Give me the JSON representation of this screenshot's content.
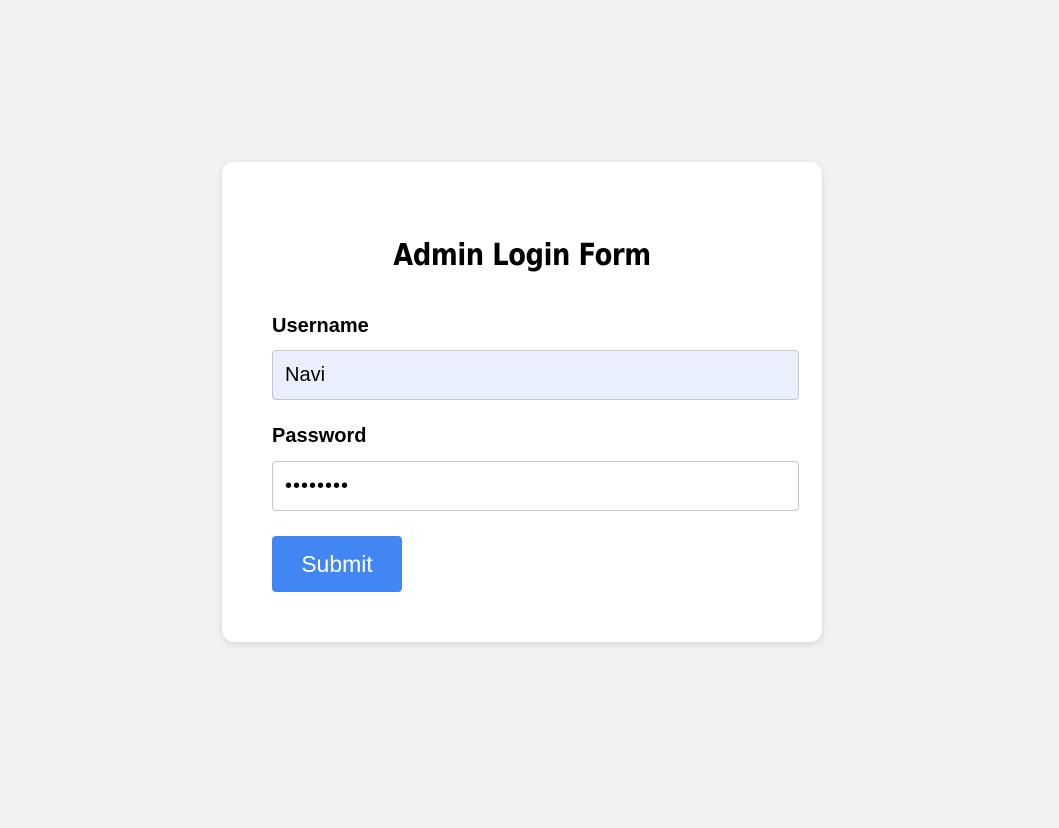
{
  "form": {
    "title": "Admin Login Form",
    "username": {
      "label": "Username",
      "value": "Navi"
    },
    "password": {
      "label": "Password",
      "value": "••••••••"
    },
    "submit_label": "Submit"
  },
  "colors": {
    "background": "#f2f2f2",
    "card": "#ffffff",
    "autofill": "#e8f0fe",
    "button": "#4286f4"
  }
}
